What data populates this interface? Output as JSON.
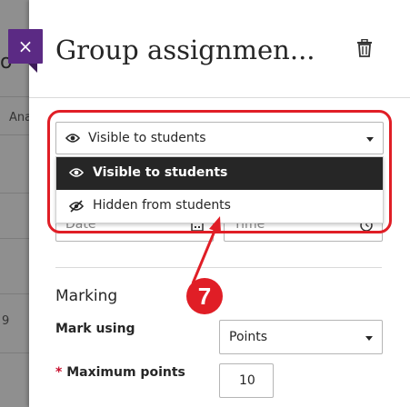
{
  "panel": {
    "title": "Group assignmen...",
    "close_symbol": "×"
  },
  "visibility": {
    "selected": "Visible to students",
    "options": [
      "Visible to students",
      "Hidden from students"
    ]
  },
  "date_fields": {
    "date_placeholder": "Date",
    "time_placeholder": "Time"
  },
  "marking": {
    "section_title": "Marking",
    "mark_using_label": "Mark using",
    "mark_using_value": "Points",
    "required_marker": "*",
    "max_points_label": "Maximum points",
    "max_points_value": "10"
  },
  "annotation": {
    "step_number": "7",
    "color": "#e01e26"
  },
  "background": {
    "fragments": [
      "Ana",
      "9",
      "o"
    ]
  },
  "colors": {
    "accent_purple": "#5b2a84",
    "selected_bg": "#262626"
  }
}
